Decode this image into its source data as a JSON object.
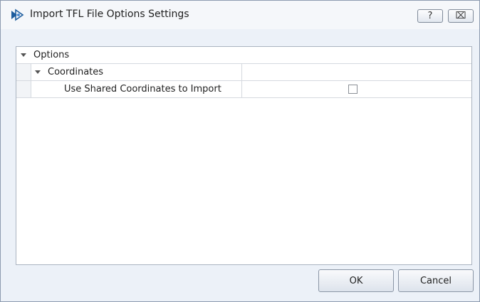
{
  "window": {
    "title": "Import TFL File Options Settings",
    "help_glyph": "?",
    "close_glyph": "⌧"
  },
  "tree": {
    "options_label": "Options",
    "coordinates_label": "Coordinates",
    "shared_coords_label": "Use Shared Coordinates to Import",
    "shared_coords_checked": false
  },
  "footer": {
    "ok_label": "OK",
    "cancel_label": "Cancel"
  },
  "icons": {
    "app": "app-logo-icon",
    "expand": "chevron-down-icon"
  },
  "colors": {
    "dialog_bg": "#ecf1f8",
    "border": "#8d9bb0",
    "accent": "#1e5d9e"
  }
}
